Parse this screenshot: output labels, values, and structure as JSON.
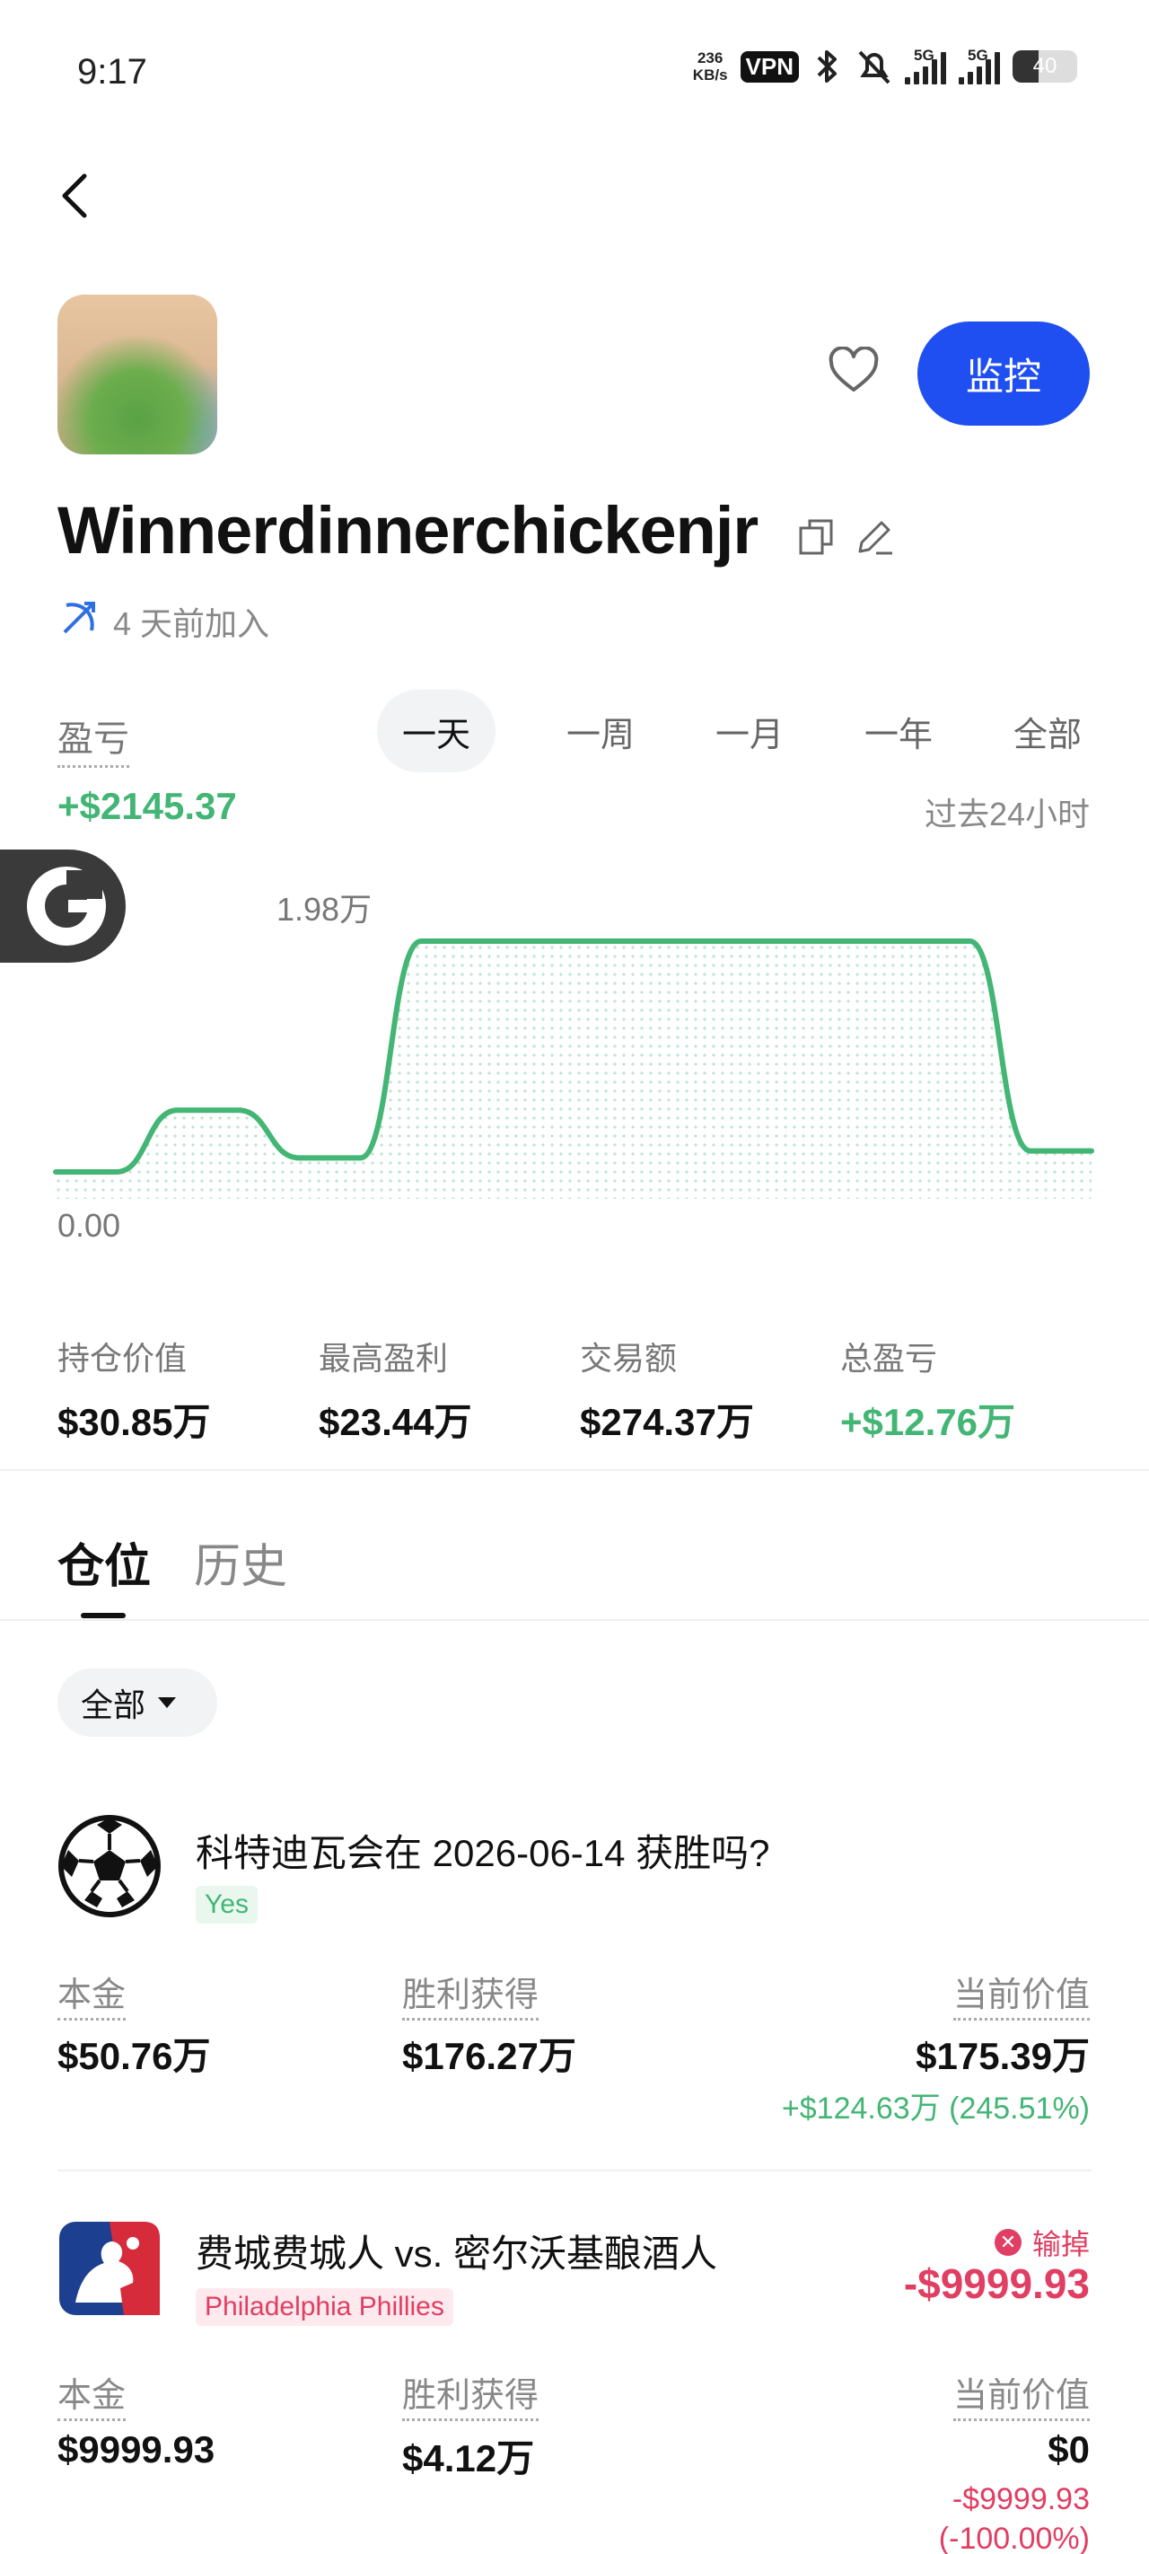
{
  "status_bar": {
    "time": "9:17",
    "speed_value": "236",
    "speed_unit": "KB/s",
    "vpn": "VPN",
    "net1": "5G",
    "net2": "5G",
    "battery": "40",
    "battery_level": 0.4
  },
  "profile": {
    "username": "Winnerdinnerchickenjr",
    "joined": "4 天前加入",
    "monitor_label": "监控"
  },
  "pnl": {
    "label": "盈亏",
    "tabs": [
      "一天",
      "一周",
      "一月",
      "一年",
      "全部"
    ],
    "active_tab": "一天",
    "value": "+$2145.37",
    "range_label": "过去24小时"
  },
  "chart_data": {
    "type": "area",
    "color": "#43b574",
    "max_label": "1.98万",
    "min_label": "0.00",
    "x": [
      0,
      1,
      2,
      3,
      4,
      5,
      6,
      7,
      8,
      9,
      10,
      11,
      12,
      13,
      14,
      15,
      16,
      17
    ],
    "values": [
      0,
      0,
      5300,
      5300,
      1200,
      1200,
      19800,
      19800,
      19800,
      19800,
      19800,
      19800,
      19800,
      19800,
      19800,
      19800,
      1800,
      1800
    ],
    "ylim": [
      0,
      19800
    ],
    "grid": false
  },
  "stats": [
    {
      "label": "持仓价值",
      "value": "$30.85万",
      "color": "#111111"
    },
    {
      "label": "最高盈利",
      "value": "$23.44万",
      "color": "#111111"
    },
    {
      "label": "交易额",
      "value": "$274.37万",
      "color": "#111111"
    },
    {
      "label": "总盈亏",
      "value": "+$12.76万",
      "color": "#43b574"
    }
  ],
  "position_tabs": {
    "positions": "仓位",
    "history": "历史"
  },
  "filter": {
    "label": "全部"
  },
  "positions": [
    {
      "icon": "soccer-ball-icon",
      "title": "科特迪瓦会在 2026-06-14 获胜吗?",
      "outcome": "Yes",
      "principal_label": "本金",
      "principal": "$50.76万",
      "payout_label": "胜利获得",
      "payout": "$176.27万",
      "value_label": "当前价值",
      "value": "$175.39万",
      "change": "+$124.63万 (245.51%)"
    },
    {
      "icon": "mlb-logo-icon",
      "title": "费城费城人 vs. 密尔沃基酿酒人",
      "outcome": "Philadelphia Phillies",
      "status": "输掉",
      "loss": "-$9999.93",
      "principal_label": "本金",
      "principal": "$9999.93",
      "payout_label": "胜利获得",
      "payout": "$4.12万",
      "value_label": "当前价值",
      "value": "$0",
      "change": "-$9999.93",
      "change_pct": "(-100.00%)"
    }
  ]
}
